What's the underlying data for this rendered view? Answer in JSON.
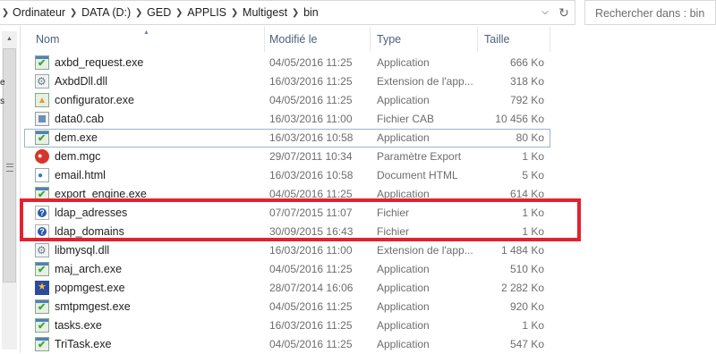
{
  "address": {
    "crumbs": [
      "Ordinateur",
      "DATA (D:)",
      "GED",
      "APPLIS",
      "Multigest",
      "bin"
    ],
    "refresh_icon": "refresh-icon",
    "dropdown_icon": "chevron-down-icon"
  },
  "search": {
    "placeholder": "Rechercher dans : bin"
  },
  "leftpane": {
    "edge_chars": [
      "e",
      "s",
      "≡"
    ]
  },
  "columns": {
    "name": "Nom",
    "modified": "Modifié le",
    "type": "Type",
    "size": "Taille",
    "sorted_by": "name"
  },
  "files": [
    {
      "name": "axbd_request.exe",
      "modified": "04/05/2016 11:25",
      "type": "Application",
      "size": "666 Ko",
      "icon": "app-icon"
    },
    {
      "name": "AxbdDll.dll",
      "modified": "16/03/2016 11:25",
      "type": "Extension de l'app...",
      "size": "318 Ko",
      "icon": "dll-icon"
    },
    {
      "name": "configurator.exe",
      "modified": "04/05/2016 11:25",
      "type": "Application",
      "size": "792 Ko",
      "icon": "configurator-icon"
    },
    {
      "name": "data0.cab",
      "modified": "16/03/2016 11:00",
      "type": "Fichier CAB",
      "size": "10 456 Ko",
      "icon": "cab-icon"
    },
    {
      "name": "dem.exe",
      "modified": "16/03/2016 10:58",
      "type": "Application",
      "size": "80 Ko",
      "icon": "app-icon"
    },
    {
      "name": "dem.mgc",
      "modified": "29/07/2011 10:34",
      "type": "Paramètre Export",
      "size": "1 Ko",
      "icon": "mgc-icon"
    },
    {
      "name": "email.html",
      "modified": "16/03/2016 10:58",
      "type": "Document HTML",
      "size": "5 Ko",
      "icon": "html-icon"
    },
    {
      "name": "export_engine.exe",
      "modified": "04/05/2016 11:25",
      "type": "Application",
      "size": "614 Ko",
      "icon": "app-icon"
    },
    {
      "name": "ldap_adresses",
      "modified": "07/07/2015 11:07",
      "type": "Fichier",
      "size": "1 Ko",
      "icon": "unknown-file-icon"
    },
    {
      "name": "ldap_domains",
      "modified": "30/09/2015 16:43",
      "type": "Fichier",
      "size": "1 Ko",
      "icon": "unknown-file-icon"
    },
    {
      "name": "libmysql.dll",
      "modified": "16/03/2016 11:00",
      "type": "Extension de l'app...",
      "size": "1 484 Ko",
      "icon": "dll-icon"
    },
    {
      "name": "maj_arch.exe",
      "modified": "04/05/2016 11:25",
      "type": "Application",
      "size": "510 Ko",
      "icon": "app-icon"
    },
    {
      "name": "popmgest.exe",
      "modified": "28/07/2014 16:06",
      "type": "Application",
      "size": "2 282 Ko",
      "icon": "popmgest-icon"
    },
    {
      "name": "smtpmgest.exe",
      "modified": "04/05/2016 11:25",
      "type": "Application",
      "size": "920 Ko",
      "icon": "app-icon"
    },
    {
      "name": "tasks.exe",
      "modified": "16/03/2016 11:25",
      "type": "Application",
      "size": "1 Ko",
      "icon": "app-icon"
    },
    {
      "name": "TriTask.exe",
      "modified": "04/05/2016 11:25",
      "type": "Application",
      "size": "547 Ko",
      "icon": "app-icon"
    }
  ],
  "focused_row": 4,
  "highlighted_rows": [
    8,
    9
  ],
  "colors": {
    "highlight_box": "#e3222f",
    "header_text": "#4c607a",
    "focus_border": "#99b4d1"
  }
}
